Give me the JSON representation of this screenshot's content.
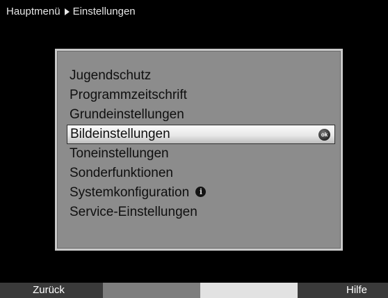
{
  "breadcrumb": {
    "root": "Hauptmenü",
    "current": "Einstellungen"
  },
  "menu": {
    "items": [
      {
        "label": "Jugendschutz"
      },
      {
        "label": "Programmzeitschrift"
      },
      {
        "label": "Grundeinstellungen"
      },
      {
        "label": "Bildeinstellungen",
        "selected": true
      },
      {
        "label": "Toneinstellungen"
      },
      {
        "label": "Sonderfunktionen"
      },
      {
        "label": "Systemkonfiguration"
      },
      {
        "label": "Service-Einstellungen"
      }
    ],
    "ok_badge": "ok",
    "info_badge": "i"
  },
  "footer": {
    "red": "Zurück",
    "green": "",
    "yellow": "",
    "blue": "Hilfe"
  }
}
